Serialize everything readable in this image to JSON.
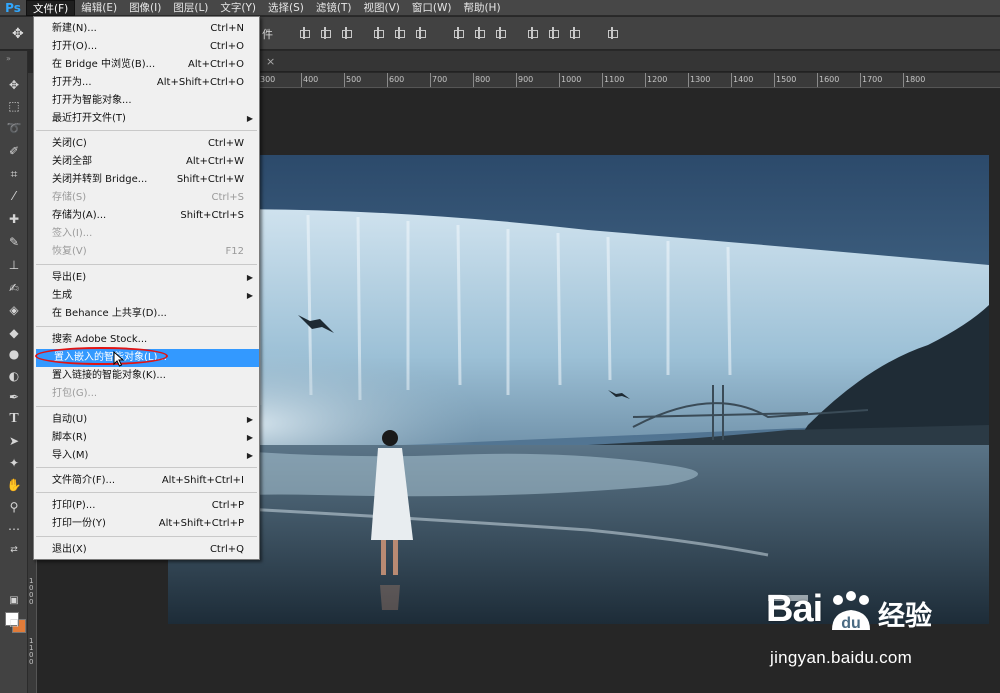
{
  "app": {
    "logo": "Ps"
  },
  "menubar": {
    "items": [
      "文件(F)",
      "编辑(E)",
      "图像(I)",
      "图层(L)",
      "文字(Y)",
      "选择(S)",
      "滤镜(T)",
      "视图(V)",
      "窗口(W)",
      "帮助(H)"
    ],
    "active_index": 0
  },
  "options_bar": {
    "partial_label": "件"
  },
  "file_menu": {
    "items": [
      {
        "label": "新建(N)...",
        "shortcut": "Ctrl+N",
        "enabled": true
      },
      {
        "label": "打开(O)...",
        "shortcut": "Ctrl+O",
        "enabled": true
      },
      {
        "label": "在 Bridge 中浏览(B)...",
        "shortcut": "Alt+Ctrl+O",
        "enabled": true
      },
      {
        "label": "打开为...",
        "shortcut": "Alt+Shift+Ctrl+O",
        "enabled": true
      },
      {
        "label": "打开为智能对象...",
        "shortcut": "",
        "enabled": true
      },
      {
        "label": "最近打开文件(T)",
        "shortcut": "",
        "enabled": true,
        "submenu": true
      },
      {
        "label": "关闭(C)",
        "shortcut": "Ctrl+W",
        "enabled": true
      },
      {
        "label": "关闭全部",
        "shortcut": "Alt+Ctrl+W",
        "enabled": true
      },
      {
        "label": "关闭并转到 Bridge...",
        "shortcut": "Shift+Ctrl+W",
        "enabled": true
      },
      {
        "label": "存储(S)",
        "shortcut": "Ctrl+S",
        "enabled": false
      },
      {
        "label": "存储为(A)...",
        "shortcut": "Shift+Ctrl+S",
        "enabled": true
      },
      {
        "label": "签入(I)...",
        "shortcut": "",
        "enabled": false
      },
      {
        "label": "恢复(V)",
        "shortcut": "F12",
        "enabled": false
      },
      {
        "label": "导出(E)",
        "shortcut": "",
        "enabled": true,
        "submenu": true
      },
      {
        "label": "生成",
        "shortcut": "",
        "enabled": true,
        "submenu": true
      },
      {
        "label": "在 Behance 上共享(D)...",
        "shortcut": "",
        "enabled": true
      },
      {
        "label": "搜索 Adobe Stock...",
        "shortcut": "",
        "enabled": true
      },
      {
        "label": "置入嵌入的智能对象(L)...",
        "shortcut": "",
        "enabled": true,
        "highlighted": true
      },
      {
        "label": "置入链接的智能对象(K)...",
        "shortcut": "",
        "enabled": true
      },
      {
        "label": "打包(G)...",
        "shortcut": "",
        "enabled": false
      },
      {
        "label": "自动(U)",
        "shortcut": "",
        "enabled": true,
        "submenu": true
      },
      {
        "label": "脚本(R)",
        "shortcut": "",
        "enabled": true,
        "submenu": true
      },
      {
        "label": "导入(M)",
        "shortcut": "",
        "enabled": true,
        "submenu": true
      },
      {
        "label": "文件简介(F)...",
        "shortcut": "Alt+Shift+Ctrl+I",
        "enabled": true
      },
      {
        "label": "打印(P)...",
        "shortcut": "Ctrl+P",
        "enabled": true
      },
      {
        "label": "打印一份(Y)",
        "shortcut": "Alt+Shift+Ctrl+P",
        "enabled": true
      },
      {
        "label": "退出(X)",
        "shortcut": "Ctrl+Q",
        "enabled": true
      }
    ]
  },
  "ruler": {
    "top_labels": [
      "300",
      "400",
      "500",
      "600",
      "700",
      "800",
      "900",
      "1000",
      "1100",
      "1200",
      "1300",
      "1400",
      "1500",
      "1600",
      "1700",
      "1800"
    ],
    "left_labels": [
      "1000",
      "1100"
    ]
  },
  "colors": {
    "foreground": "#ffffff",
    "background": "#e07b39",
    "highlight": "#3399ff"
  },
  "watermark": {
    "brand": "Bai",
    "brand_cn": "经验",
    "url": "jingyan.baidu.com"
  }
}
